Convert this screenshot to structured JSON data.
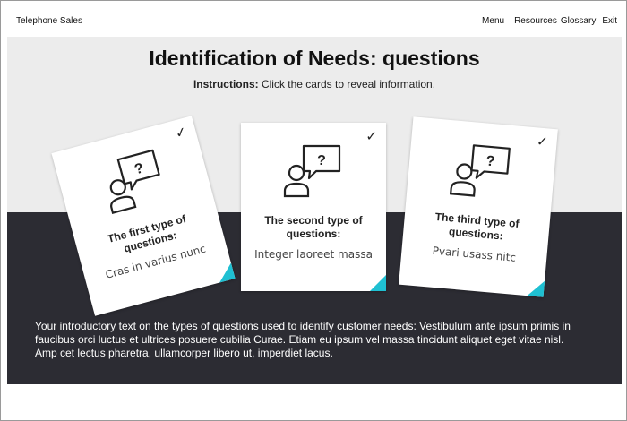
{
  "app": {
    "title": "Telephone Sales"
  },
  "nav": {
    "menu": "Menu",
    "resources": "Resources",
    "glossary": "Glossary",
    "exit": "Exit"
  },
  "page": {
    "title": "Identification of Needs: questions",
    "instructions_label": "Instructions:",
    "instructions_text": " Click the cards to reveal information.",
    "intro": "Your introductory text on the types of questions used to identify customer needs: Vestibulum ante ipsum primis in faucibus orci luctus et ultrices posuere cubilia Curae. Etiam eu ipsum vel massa tincidunt aliquet eget vitae nisl. Amp cet lectus pharetra, ullamcorper libero ut, imperdiet lacus."
  },
  "cards": [
    {
      "heading": "The first type of questions:",
      "body": "Cras in varius nunc",
      "icon": "person-question-icon",
      "checked": true
    },
    {
      "heading": "The second type of questions:",
      "body": "Integer laoreet massa",
      "icon": "person-question-icon",
      "checked": true
    },
    {
      "heading": "The third type of questions:",
      "body": "Pvari usass nitc",
      "icon": "person-question-icon",
      "checked": true
    }
  ],
  "colors": {
    "accent": "#1fc0d2",
    "dark_band": "#2c2c33",
    "light_band": "#ececec"
  }
}
